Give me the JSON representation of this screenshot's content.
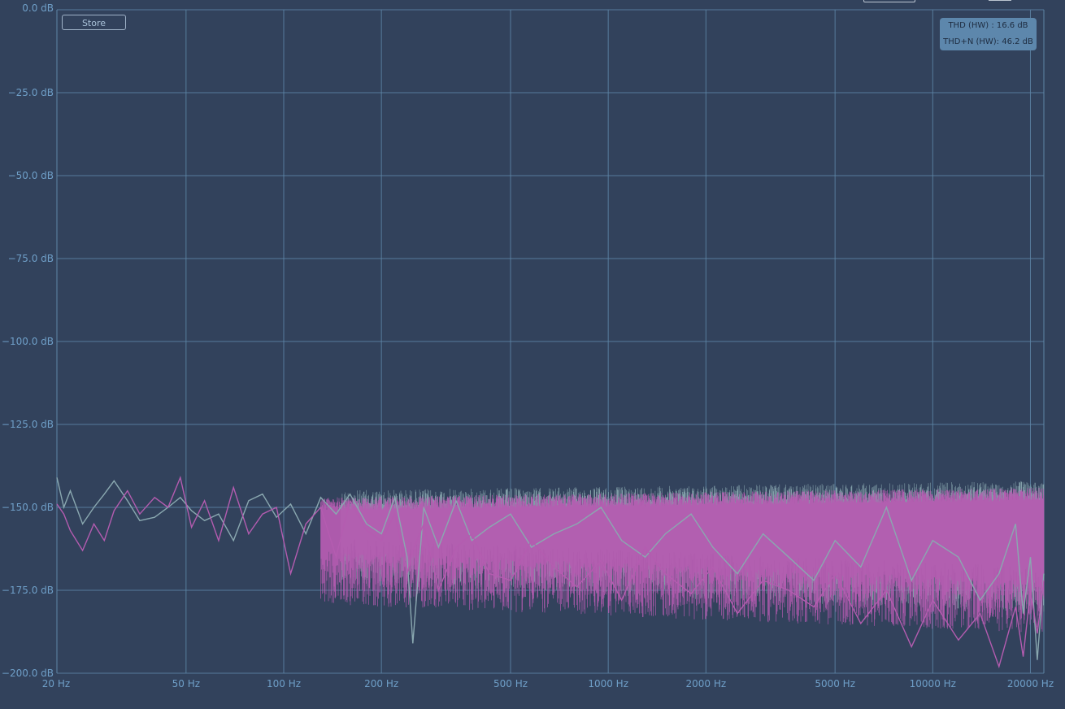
{
  "store_label": "Store",
  "readout": {
    "thd": "THD (HW) : 16.6 dB",
    "thdn": "THD+N (HW): 46.2 dB"
  },
  "colors": {
    "background": "#32425c",
    "grid": "#5e86a6",
    "label": "#6f9fc8",
    "series_gray": "#8aa8b0",
    "series_magenta": "#b45cb0"
  },
  "chart_data": {
    "type": "line",
    "x_scale": "log",
    "xlim": [
      20,
      22000
    ],
    "ylim": [
      -200,
      0
    ],
    "y_ticks": [
      0,
      -25,
      -50,
      -75,
      -100,
      -125,
      -150,
      -175,
      -200
    ],
    "y_tick_labels": [
      "0.0 dB",
      "−25.0 dB",
      "−50.0 dB",
      "−75.0 dB",
      "−100.0 dB",
      "−125.0 dB",
      "−150.0 dB",
      "−175.0 dB",
      "−200.0 dB"
    ],
    "x_ticks": [
      20,
      50,
      100,
      200,
      500,
      1000,
      2000,
      5000,
      10000,
      20000
    ],
    "x_tick_labels": [
      "20 Hz",
      "50 Hz",
      "100 Hz",
      "200 Hz",
      "500 Hz",
      "1000 Hz",
      "2000 Hz",
      "5000 Hz",
      "10000 Hz",
      "20000 Hz"
    ],
    "grid": true,
    "series": [
      {
        "color": "#8aa8b0",
        "x": [
          20,
          21,
          22,
          24,
          26,
          28,
          30,
          33,
          36,
          40,
          44,
          48,
          52,
          57,
          63,
          70,
          78,
          86,
          95,
          105,
          117,
          130,
          145,
          160,
          180,
          200,
          220,
          240,
          250,
          270,
          300,
          340,
          380,
          430,
          500,
          580,
          680,
          800,
          950,
          1100,
          1300,
          1500,
          1800,
          2100,
          2500,
          3000,
          3600,
          4300,
          5000,
          6000,
          7200,
          8600,
          10000,
          12000,
          14000,
          16000,
          18000,
          19000,
          20000,
          21000,
          22000
        ],
        "y": [
          -141,
          -150,
          -145,
          -155,
          -150,
          -146,
          -142,
          -148,
          -154,
          -153,
          -150,
          -147,
          -151,
          -154,
          -152,
          -160,
          -148,
          -146,
          -153,
          -149,
          -158,
          -147,
          -152,
          -146,
          -155,
          -158,
          -147,
          -165,
          -191,
          -150,
          -162,
          -148,
          -160,
          -156,
          -152,
          -162,
          -158,
          -155,
          -150,
          -160,
          -165,
          -158,
          -152,
          -162,
          -170,
          -158,
          -165,
          -172,
          -160,
          -168,
          -150,
          -172,
          -160,
          -165,
          -178,
          -170,
          -155,
          -182,
          -165,
          -196,
          -170
        ]
      },
      {
        "color": "#b45cb0",
        "x": [
          20,
          21,
          22,
          24,
          26,
          28,
          30,
          33,
          36,
          40,
          44,
          48,
          52,
          57,
          63,
          70,
          78,
          86,
          95,
          105,
          117,
          130,
          145,
          160,
          180,
          200,
          220,
          240,
          250,
          270,
          300,
          340,
          380,
          430,
          500,
          580,
          680,
          800,
          950,
          1100,
          1300,
          1500,
          1800,
          2100,
          2500,
          3000,
          3600,
          4300,
          5000,
          6000,
          7200,
          8600,
          10000,
          12000,
          14000,
          16000,
          18000,
          19000,
          20000,
          21000,
          22000
        ],
        "y": [
          -149,
          -152,
          -157,
          -163,
          -155,
          -160,
          -151,
          -145,
          -152,
          -147,
          -150,
          -141,
          -156,
          -148,
          -160,
          -144,
          -158,
          -152,
          -150,
          -170,
          -155,
          -150,
          -165,
          -148,
          -157,
          -160,
          -152,
          -170,
          -163,
          -155,
          -175,
          -162,
          -158,
          -170,
          -172,
          -160,
          -168,
          -174,
          -166,
          -178,
          -162,
          -170,
          -176,
          -168,
          -182,
          -172,
          -175,
          -180,
          -170,
          -185,
          -175,
          -192,
          -178,
          -190,
          -182,
          -198,
          -180,
          -195,
          -175,
          -188,
          -172
        ]
      }
    ]
  }
}
